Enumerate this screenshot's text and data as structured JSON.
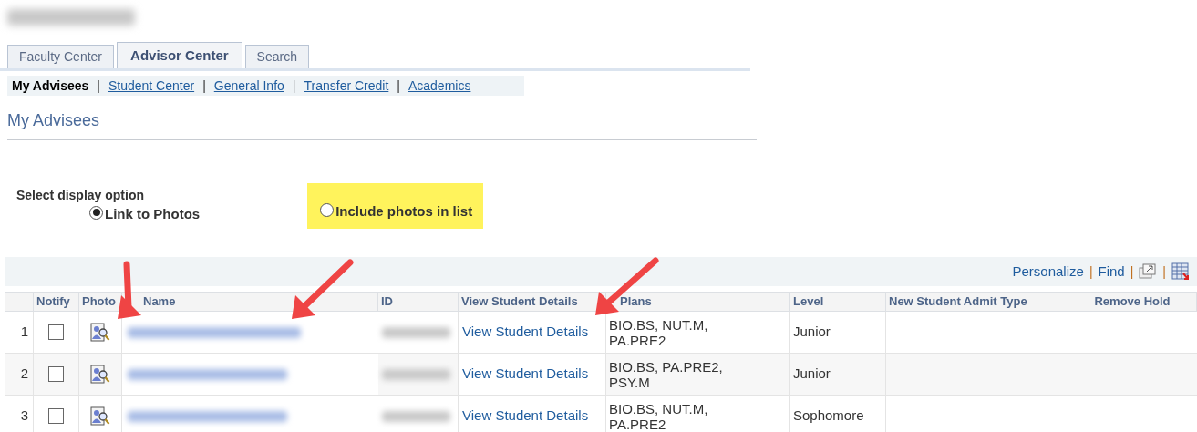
{
  "tabs": [
    {
      "label": "Faculty Center",
      "selected": false
    },
    {
      "label": "Advisor Center",
      "selected": true
    },
    {
      "label": "Search",
      "selected": false
    }
  ],
  "subnav": [
    {
      "label": "My Advisees",
      "selected": true
    },
    {
      "label": "Student Center",
      "selected": false
    },
    {
      "label": "General Info",
      "selected": false
    },
    {
      "label": "Transfer Credit",
      "selected": false
    },
    {
      "label": "Academics",
      "selected": false
    }
  ],
  "subnav_separator": "|",
  "page_title": "My Advisees",
  "display_option": {
    "label": "Select display option",
    "options": [
      {
        "label": "Link to Photos",
        "selected": true,
        "highlighted": false
      },
      {
        "label": "Include photos in list",
        "selected": false,
        "highlighted": true
      }
    ]
  },
  "grid_toolbar": {
    "links": [
      "Personalize",
      "Find"
    ],
    "separator": "|"
  },
  "table": {
    "columns": [
      "Notify",
      "Photo",
      "Name",
      "ID",
      "View Student Details",
      "Plans",
      "Level",
      "New Student Admit Type",
      "Remove Hold"
    ],
    "rows": [
      {
        "number": "1",
        "notify": false,
        "details": "View Student Details",
        "plans": "BIO.BS, NUT.M, PA.PRE2",
        "level": "Junior"
      },
      {
        "number": "2",
        "notify": false,
        "details": "View Student Details",
        "plans": "BIO.BS, PA.PRE2, PSY.M",
        "level": "Junior"
      },
      {
        "number": "3",
        "notify": false,
        "details": "View Student Details",
        "plans": "BIO.BS, NUT.M, PA.PRE2",
        "level": "Sophomore"
      }
    ]
  }
}
